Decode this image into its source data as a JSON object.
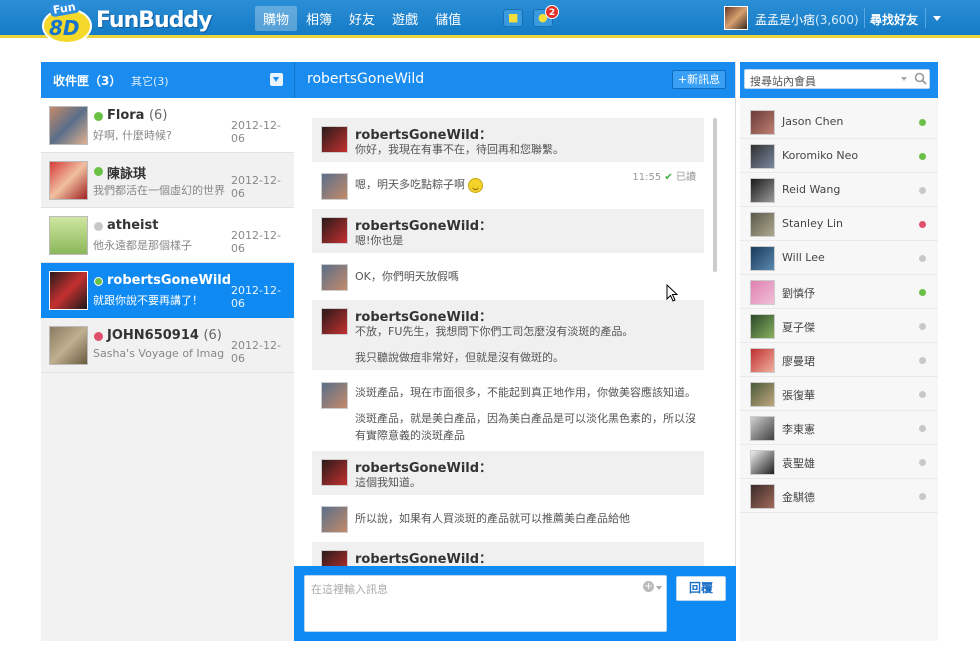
{
  "app": {
    "brand_badge": "Fun",
    "brand_badge_num": "8D",
    "brand_name": "FunBuddy"
  },
  "nav": [
    "購物",
    "相簿",
    "好友",
    "遊戲",
    "儲值"
  ],
  "notifications": {
    "count": "2"
  },
  "user": {
    "name": "孟孟是小痞",
    "points": "(3,600)",
    "find_friends": "尋找好友"
  },
  "inbox": {
    "label": "收件匣（3）",
    "other": "其它(3)"
  },
  "conversations": [
    {
      "name": "Flora",
      "count": "(6)",
      "preview": "好啊, 什麼時候?",
      "date": "2012-12-06",
      "status": "online"
    },
    {
      "name": "陳詠琪",
      "count": "",
      "preview": "我們都活在一個虛幻的世界",
      "date": "2012-12-06",
      "status": "online"
    },
    {
      "name": "atheist",
      "count": "",
      "preview": "他永遠都是那個樣子",
      "date": "2012-12-06",
      "status": "offline"
    },
    {
      "name": "robertsGoneWild",
      "count": "",
      "preview": "就跟你說不要再講了！",
      "date": "2012-12-06",
      "status": "online"
    },
    {
      "name": "JOHN650914",
      "count": "(6)",
      "preview": "Sasha's Voyage of Imagina",
      "date": "2012-12-06",
      "status": "busy"
    }
  ],
  "chat": {
    "title": "robertsGoneWild",
    "new_message": "+新訊息",
    "input_placeholder": "在這裡輸入訊息",
    "reply": "回覆",
    "messages": [
      {
        "sender": "robertsGoneWild：",
        "lines": [
          "你好，我現在有事不在，待回再和您聯繫。"
        ]
      },
      {
        "sender": "",
        "lines": [
          "嗯，明天多吃點粽子啊"
        ],
        "time": "11:55",
        "read": "已讀"
      },
      {
        "sender": "robertsGoneWild：",
        "lines": [
          "嗯!你也是"
        ]
      },
      {
        "sender": "",
        "lines": [
          "OK，你們明天放假嗎"
        ]
      },
      {
        "sender": "robertsGoneWild：",
        "lines": [
          "不放，FU先生，我想問下你們工司怎麼沒有淡斑的產品。",
          "我只聽說做痘非常好，但就是沒有做斑的。"
        ]
      },
      {
        "sender": "",
        "lines": [
          "淡斑產品，現在市面很多，不能起到真正地作用，你做美容應該知道。",
          "淡斑產品，就是美白產品，因為美白產品是可以淡化黑色素的，所以沒",
          "有實際意義的淡斑產品"
        ]
      },
      {
        "sender": "robertsGoneWild：",
        "lines": [
          "這個我知道。"
        ]
      },
      {
        "sender": "",
        "lines": [
          "所以說，如果有人買淡斑的產品就可以推薦美白產品給他"
        ]
      },
      {
        "sender": "robertsGoneWild：",
        "lines": []
      }
    ]
  },
  "members": {
    "search_placeholder": "搜尋站內會員",
    "list": [
      {
        "name": "Jason Chen",
        "status": "online"
      },
      {
        "name": "Koromiko Neo",
        "status": "online"
      },
      {
        "name": "Reid Wang",
        "status": "offline"
      },
      {
        "name": "Stanley Lin",
        "status": "busy"
      },
      {
        "name": "Will Lee",
        "status": "offline"
      },
      {
        "name": "劉慎伃",
        "status": "online"
      },
      {
        "name": "夏子傑",
        "status": "offline"
      },
      {
        "name": "廖曼珺",
        "status": "offline"
      },
      {
        "name": "張復華",
        "status": "offline"
      },
      {
        "name": "李東憲",
        "status": "offline"
      },
      {
        "name": "袁聖雄",
        "status": "offline"
      },
      {
        "name": "金騏德",
        "status": "offline"
      }
    ]
  },
  "colors": {
    "accent": "#1a8cf0",
    "online": "#6ac146",
    "busy": "#e0506a",
    "offline": "#c8c8c8",
    "topbar": "#2b8fd6"
  }
}
